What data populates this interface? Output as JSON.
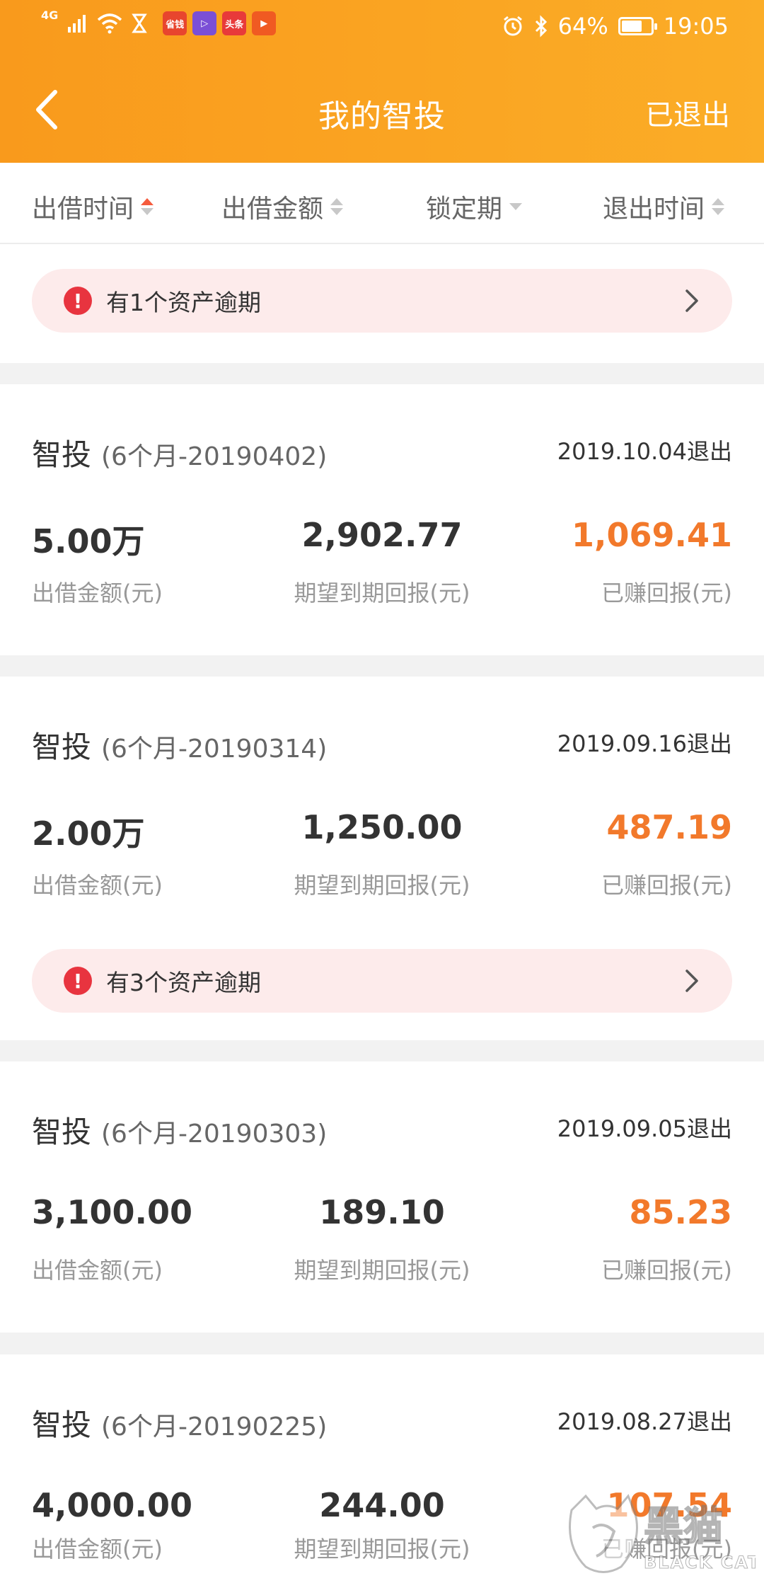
{
  "status_bar": {
    "network": "4G",
    "apps": [
      "省钱",
      "▷",
      "头条",
      "▶"
    ],
    "battery": "64%",
    "time": "19:05"
  },
  "nav": {
    "title": "我的智投",
    "action": "已退出"
  },
  "sort_bar": {
    "items": [
      "出借时间",
      "出借金额",
      "锁定期",
      "退出时间"
    ]
  },
  "top_alert": {
    "text": "有1个资产逾期"
  },
  "labels": {
    "amount": "出借金额(元)",
    "expected": "期望到期回报(元)",
    "earned": "已赚回报(元)"
  },
  "cards": [
    {
      "name": "智投",
      "code": "(6个月-20190402)",
      "exit": "2019.10.04退出",
      "amount": "5.00万",
      "expected": "2,902.77",
      "earned": "1,069.41"
    },
    {
      "name": "智投",
      "code": "(6个月-20190314)",
      "exit": "2019.09.16退出",
      "amount": "2.00万",
      "expected": "1,250.00",
      "earned": "487.19",
      "alert": "有3个资产逾期"
    },
    {
      "name": "智投",
      "code": "(6个月-20190303)",
      "exit": "2019.09.05退出",
      "amount": "3,100.00",
      "expected": "189.10",
      "earned": "85.23"
    },
    {
      "name": "智投",
      "code": "(6个月-20190225)",
      "exit": "2019.08.27退出",
      "amount": "4,000.00",
      "expected": "244.00",
      "earned": "107.54"
    }
  ],
  "watermark": {
    "cn": "黑猫",
    "en": "BLACK CAT"
  },
  "colors": {
    "header_start": "#f99a1c",
    "header_end": "#fbad27",
    "earned": "#f2792b",
    "alert_bg": "#fdebeb",
    "alert_icon": "#e8343f",
    "sort_active": "#f55b3d"
  }
}
